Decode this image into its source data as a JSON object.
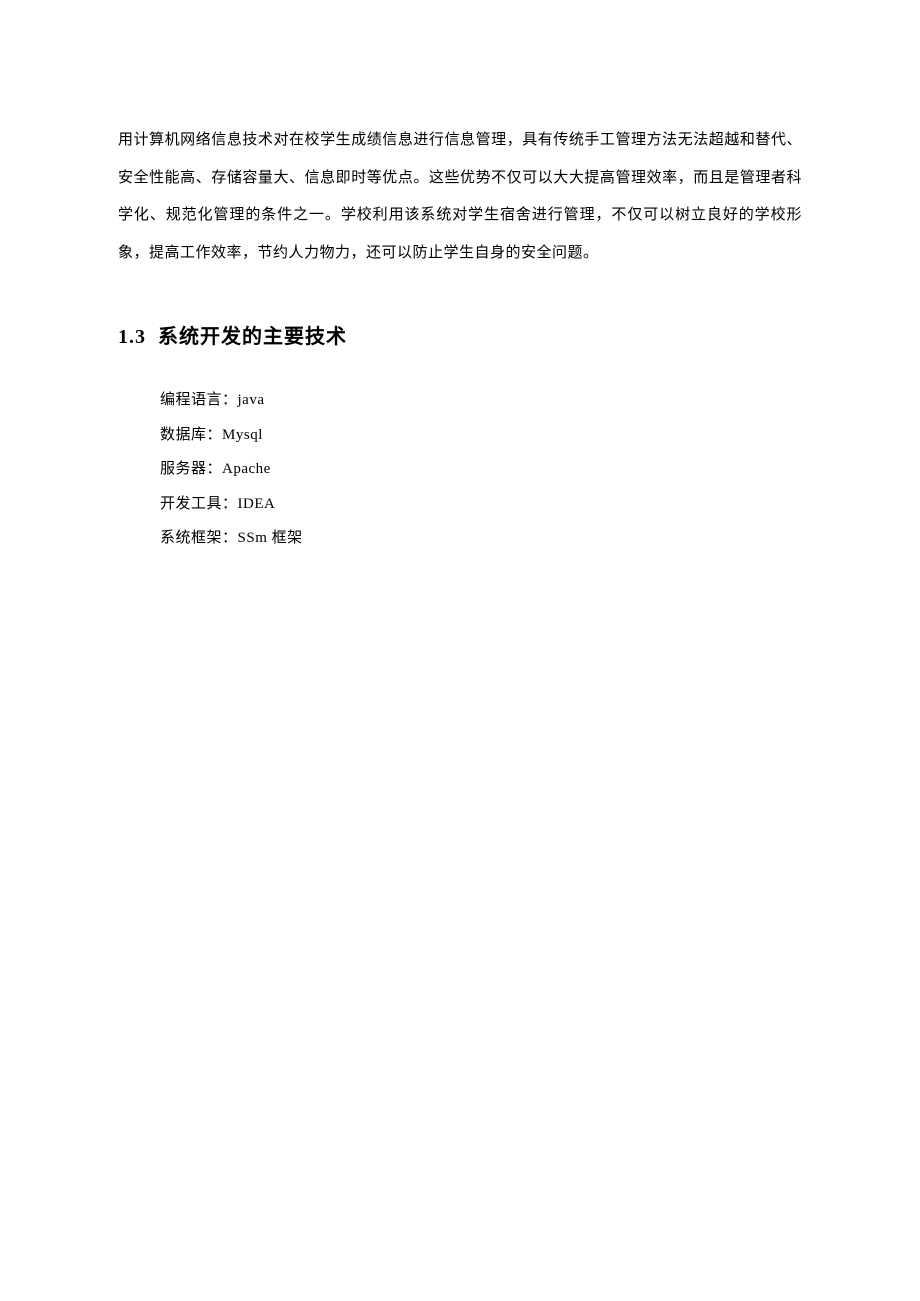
{
  "intro_paragraph": "用计算机网络信息技术对在校学生成绩信息进行信息管理，具有传统手工管理方法无法超越和替代、安全性能高、存储容量大、信息即时等优点。这些优势不仅可以大大提高管理效率，而且是管理者科学化、规范化管理的条件之一。学校利用该系统对学生宿舍进行管理，不仅可以树立良好的学校形象，提高工作效率，节约人力物力，还可以防止学生自身的安全问题。",
  "section": {
    "number": "1.3",
    "title": "系统开发的主要技术"
  },
  "tech": {
    "items": [
      {
        "label": "编程语言：",
        "value": "java"
      },
      {
        "label": "数据库：",
        "value": "Mysql"
      },
      {
        "label": "服务器：",
        "value": "Apache"
      },
      {
        "label": "开发工具：",
        "value": "IDEA"
      },
      {
        "label": "系统框架：",
        "value": "SSm 框架"
      }
    ]
  }
}
